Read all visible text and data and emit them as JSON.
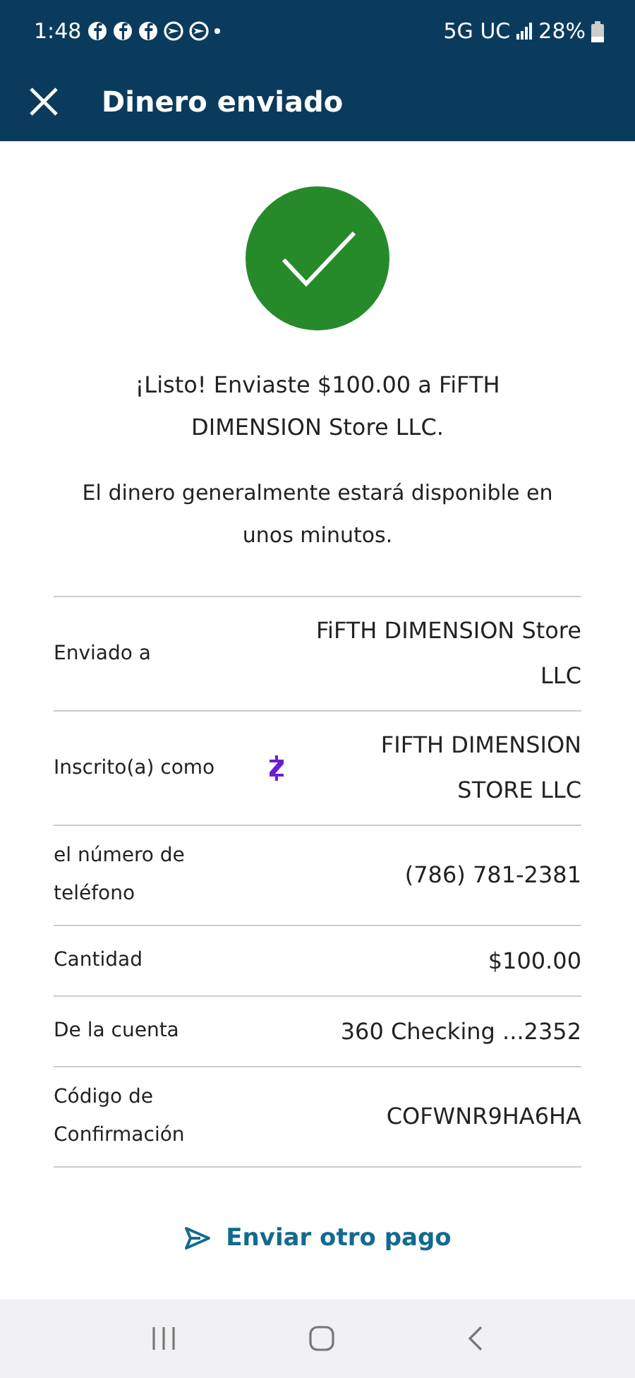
{
  "status_bar": {
    "time": "1:48",
    "network": "5G UC",
    "battery": "28%"
  },
  "app_bar": {
    "title": "Dinero enviado"
  },
  "message": "¡Listo! Enviaste $100.00 a FiFTH DIMENSION Store LLC.",
  "note": "El dinero generalmente estará disponible en unos minutos.",
  "details": [
    {
      "label": "Enviado a",
      "value": "FiFTH DIMENSION Store LLC",
      "kind": "plain"
    },
    {
      "label": "Inscrito(a) como",
      "value": "FIFTH DIMENSION STORE LLC",
      "kind": "enrolled"
    },
    {
      "label": "el número de teléfono",
      "value": "(786) 781-2381",
      "kind": "plain"
    },
    {
      "label": "Cantidad",
      "value": "$100.00",
      "kind": "plain"
    },
    {
      "label": "De la cuenta",
      "value": "360 Checking ...2352",
      "kind": "plain"
    },
    {
      "label": "Código de Confirmación",
      "value": "COFWNR9HA6HA",
      "kind": "plain"
    }
  ],
  "action": "Enviar otro pago"
}
